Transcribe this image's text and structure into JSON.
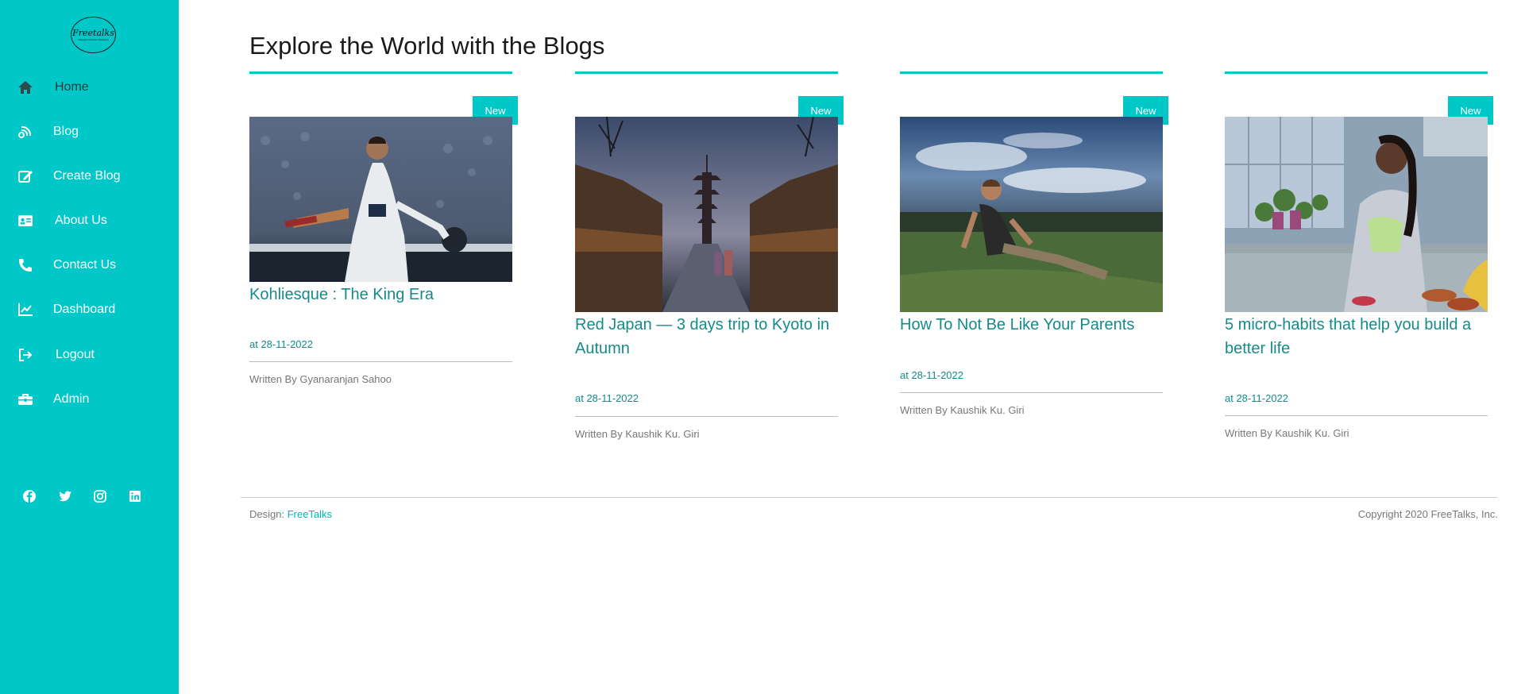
{
  "brand": {
    "name": "Freetalks",
    "tagline": "Thoughts that ll be Published"
  },
  "sidebar": {
    "items": [
      {
        "label": "Home",
        "icon": "home-icon"
      },
      {
        "label": "Blog",
        "icon": "blog-icon"
      },
      {
        "label": "Create Blog",
        "icon": "edit-icon"
      },
      {
        "label": "About Us",
        "icon": "id-card-icon"
      },
      {
        "label": "Contact Us",
        "icon": "phone-icon"
      },
      {
        "label": "Dashboard",
        "icon": "chart-line-icon"
      },
      {
        "label": "Logout",
        "icon": "logout-icon"
      },
      {
        "label": "Admin",
        "icon": "toolbox-icon"
      }
    ],
    "social": [
      "facebook-icon",
      "twitter-icon",
      "instagram-icon",
      "linkedin-icon"
    ]
  },
  "main": {
    "title": "Explore the World with the Blogs",
    "cards": [
      {
        "badge": "New",
        "title": "Kohliesque : The King Era",
        "date": "at 28-11-2022",
        "author": "Written By Gyanaranjan Sahoo"
      },
      {
        "badge": "New",
        "title": "Red Japan — 3 days trip to Kyoto in Autumn",
        "date": "at 28-11-2022",
        "author": "Written By Kaushik Ku. Giri"
      },
      {
        "badge": "New",
        "title": "How To Not Be Like Your Parents",
        "date": "at 28-11-2022",
        "author": "Written By Kaushik Ku. Giri"
      },
      {
        "badge": "New",
        "title": "5 micro-habits that help you build a better life",
        "date": "at 28-11-2022",
        "author": "Written By Kaushik Ku. Giri"
      }
    ]
  },
  "footer": {
    "design_prefix": "Design: ",
    "design_link": "FreeTalks",
    "copyright": "Copyright 2020 FreeTalks, Inc."
  },
  "colors": {
    "accent": "#00c8c8",
    "link": "#168a8a"
  }
}
